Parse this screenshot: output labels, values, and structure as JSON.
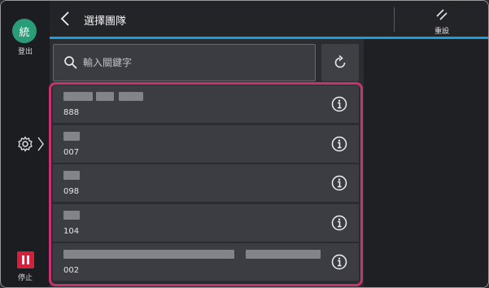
{
  "rail": {
    "avatar_text": "統",
    "logout_label": "登出",
    "stop_label": "停止"
  },
  "header": {
    "title": "選擇團隊",
    "reset_label": "重設"
  },
  "search": {
    "placeholder": "輸入關鍵字",
    "value": ""
  },
  "teams": [
    {
      "code": "888"
    },
    {
      "code": "007"
    },
    {
      "code": "098"
    },
    {
      "code": "104"
    },
    {
      "code": "002"
    }
  ],
  "colors": {
    "accent": "#1a9fd9",
    "selection_outline": "#c7336e",
    "avatar": "#2a9d78",
    "stop": "#d4213b"
  }
}
